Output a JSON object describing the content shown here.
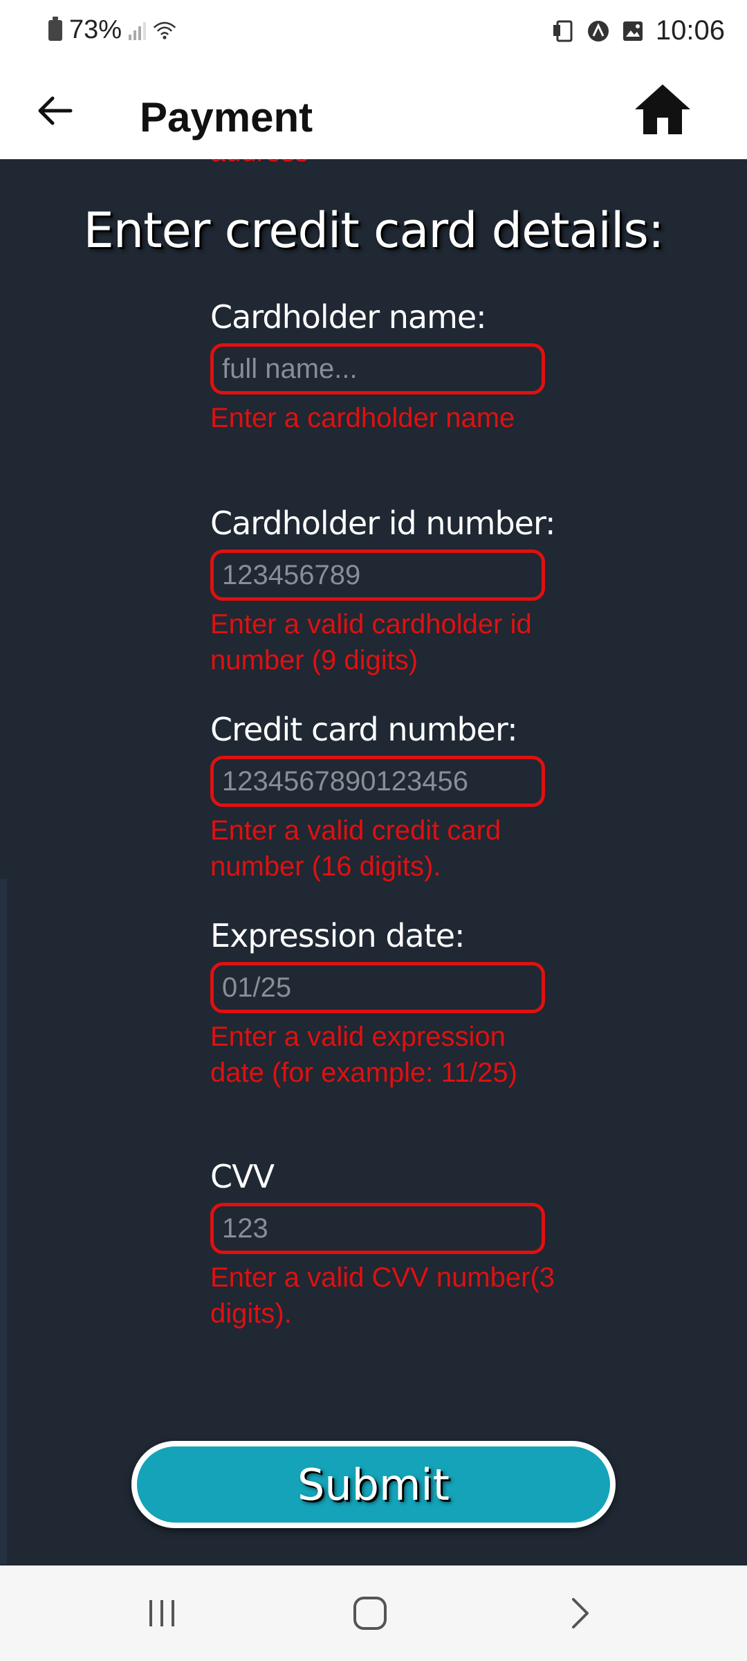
{
  "status_bar": {
    "battery": "73%",
    "time": "10:06"
  },
  "app_bar": {
    "title": "Payment"
  },
  "form": {
    "clipped_error": "address",
    "heading": "Enter credit card details:",
    "fields": [
      {
        "label": "Cardholder name:",
        "placeholder": "full name...",
        "error": "Enter a cardholder name"
      },
      {
        "label": "Cardholder id number:",
        "placeholder": "123456789",
        "error": "Enter a valid cardholder id number (9 digits)"
      },
      {
        "label": "Credit card number:",
        "placeholder": "1234567890123456",
        "error": "Enter a valid credit card number (16 digits)."
      },
      {
        "label": "Expression date:",
        "placeholder": "01/25",
        "error": "Enter a valid expression date (for example: 11/25)"
      },
      {
        "label": "CVV",
        "placeholder": "123",
        "error": "Enter a valid CVV number(3 digits)."
      }
    ],
    "submit_label": "Submit"
  },
  "colors": {
    "background": "#1f2833",
    "error": "#e01010",
    "submit": "#14a3b8"
  },
  "icons": [
    "battery-icon",
    "signal-icon",
    "wifi-icon",
    "cast-icon",
    "app-notification-icon",
    "image-notification-icon",
    "back-arrow-icon",
    "home-icon",
    "recent-apps-icon",
    "home-nav-icon",
    "back-nav-icon"
  ]
}
